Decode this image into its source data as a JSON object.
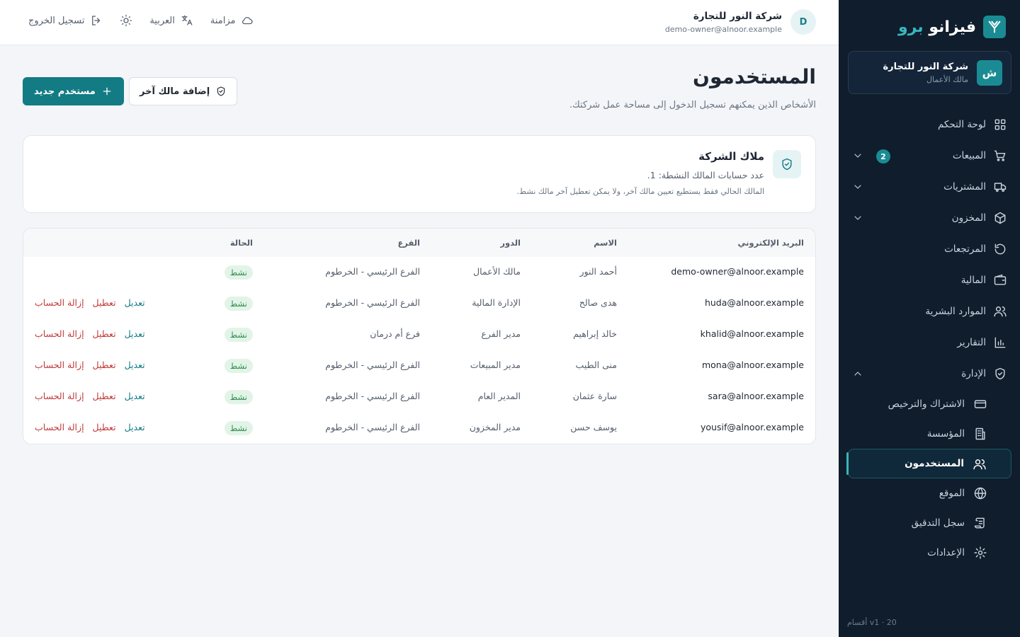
{
  "brand": {
    "name_main": "فيزانو",
    "name_accent": "برو"
  },
  "org": {
    "avatar_letter": "ش",
    "name": "شركة النور للتجارة",
    "role": "مالك الأعمال"
  },
  "nav": {
    "dashboard": "لوحة التحكم",
    "sales": "المبيعات",
    "sales_badge": "2",
    "purchases": "المشتريات",
    "inventory": "المخزون",
    "returns": "المرتجعات",
    "finance": "المالية",
    "hr": "الموارد البشرية",
    "reports": "التقارير",
    "admin": "الإدارة",
    "subscription": "الاشتراك والترخيص",
    "organization": "المؤسسة",
    "users": "المستخدمون",
    "website": "الموقع",
    "audit": "سجل التدقيق",
    "settings": "الإعدادات"
  },
  "sidebar_footer": "v1 · 20 أقسام",
  "topbar": {
    "user_initial": "D",
    "company": "شركة النور للتجارة",
    "email": "demo-owner@alnoor.example",
    "sync": "مزامنة",
    "language": "العربية",
    "logout": "تسجيل الخروج"
  },
  "page": {
    "title": "المستخدمون",
    "subtitle": "الأشخاص الذين يمكنهم تسجيل الدخول إلى مساحة عمل شركتك.",
    "new_user": "مستخدم جديد",
    "add_owner": "إضافة مالك آخر"
  },
  "owners": {
    "title": "ملاك الشركة",
    "count": "عدد حسابات المالك النشطة: 1.",
    "note": "المالك الحالي فقط يستطيع تعيين مالك آخر، ولا يمكن تعطيل آخر مالك نشط."
  },
  "table": {
    "headers": {
      "email": "البريد الإلكتروني",
      "name": "الاسم",
      "role": "الدور",
      "branch": "الفرع",
      "status": "الحالة"
    },
    "actions": {
      "edit": "تعديل",
      "disable": "تعطيل",
      "remove": "إزالة الحساب"
    },
    "rows": [
      {
        "email": "demo-owner@alnoor.example",
        "name": "أحمد النور",
        "role": "مالك الأعمال",
        "branch": "الفرع الرئيسي - الخرطوم",
        "status": "نشط"
      },
      {
        "email": "huda@alnoor.example",
        "name": "هدى صالح",
        "role": "الإدارة المالية",
        "branch": "الفرع الرئيسي - الخرطوم",
        "status": "نشط"
      },
      {
        "email": "khalid@alnoor.example",
        "name": "خالد إبراهيم",
        "role": "مدير الفرع",
        "branch": "فرع أم درمان",
        "status": "نشط"
      },
      {
        "email": "mona@alnoor.example",
        "name": "منى الطيب",
        "role": "مدير المبيعات",
        "branch": "الفرع الرئيسي - الخرطوم",
        "status": "نشط"
      },
      {
        "email": "sara@alnoor.example",
        "name": "سارة عثمان",
        "role": "المدير العام",
        "branch": "الفرع الرئيسي - الخرطوم",
        "status": "نشط"
      },
      {
        "email": "yousif@alnoor.example",
        "name": "يوسف حسن",
        "role": "مدير المخزون",
        "branch": "الفرع الرئيسي - الخرطوم",
        "status": "نشط"
      }
    ]
  },
  "colors": {
    "accent": "#137b84",
    "sidebar_bg": "#0f1d2c",
    "danger": "#c23a3a",
    "success": "#2f8a4a"
  }
}
